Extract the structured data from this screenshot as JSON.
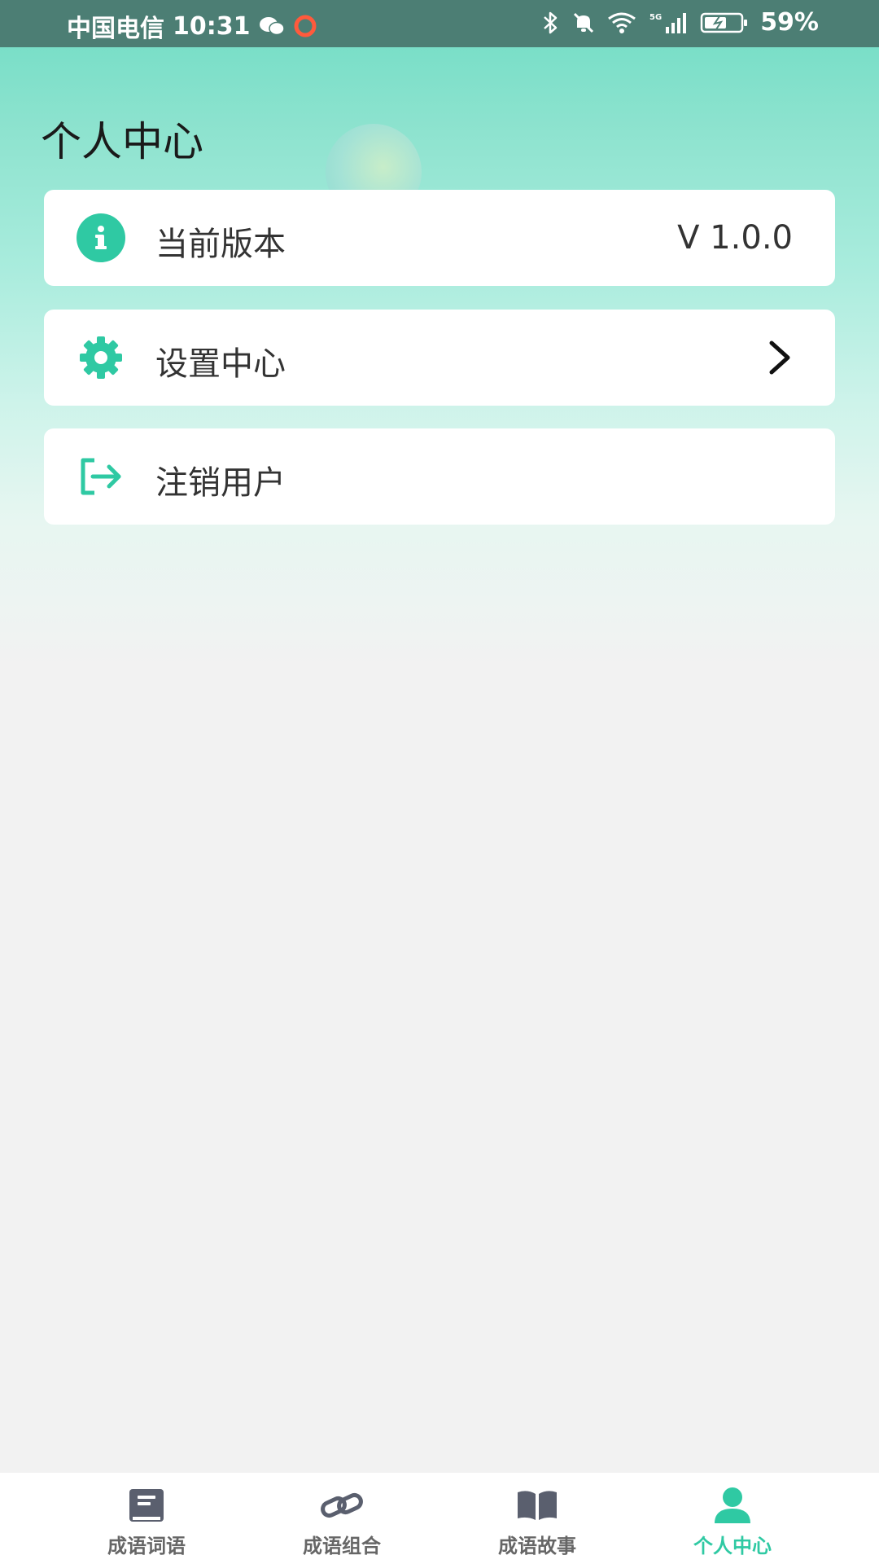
{
  "status_bar": {
    "carrier": "中国电信",
    "time": "10:31",
    "battery": "59%"
  },
  "page": {
    "title": "个人中心"
  },
  "cards": [
    {
      "label": "当前版本",
      "value": "V 1.0.0",
      "icon": "info-icon"
    },
    {
      "label": "设置中心",
      "icon": "gear-icon"
    },
    {
      "label": "注销用户",
      "icon": "logout-icon"
    }
  ],
  "bottom_nav": [
    {
      "label": "成语词语",
      "icon": "book-icon",
      "active": false
    },
    {
      "label": "成语组合",
      "icon": "link-icon",
      "active": false
    },
    {
      "label": "成语故事",
      "icon": "open-book-icon",
      "active": false
    },
    {
      "label": "个人中心",
      "icon": "person-icon",
      "active": true
    }
  ],
  "colors": {
    "accent": "#2fc9a3",
    "status_bar": "#4c7e74",
    "nav_inactive": "#666666",
    "card_bg": "#ffffff"
  }
}
